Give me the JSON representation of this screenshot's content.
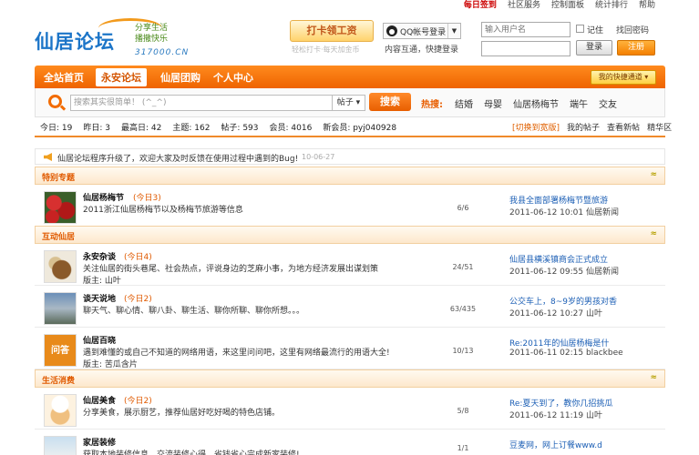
{
  "topbar": {
    "sign_in": "每日签到",
    "community": "社区服务",
    "control": "控制面板",
    "stats": "统计排行",
    "help": "帮助"
  },
  "logo": {
    "name": "仙居论坛",
    "slogan_1": "分享生活",
    "slogan_2": "播撒快乐",
    "domain": "317000.CN"
  },
  "punch": {
    "label": "打卡领工资",
    "sub": "轻松打卡·每天加金币"
  },
  "qq_login": {
    "label": "QQ帐号登录",
    "sub": "内容互通，快捷登录"
  },
  "login": {
    "username_placeholder": "输入用户名",
    "remember": "记住",
    "find_password": "找回密码",
    "login_label": "登录",
    "register_label": "注册"
  },
  "nav": {
    "items": [
      "全站首页",
      "永安论坛",
      "仙居团购",
      "个人中心"
    ],
    "quick_access": "我的快捷通道"
  },
  "search": {
    "placeholder": "搜索其实很简单！ (^_^)",
    "type": "帖子",
    "button": "搜索",
    "hot_label": "热搜:",
    "hot_tags": [
      "结婚",
      "母婴",
      "仙居杨梅节",
      "端午",
      "交友"
    ]
  },
  "stats": {
    "today": "今日: 19",
    "yesterday": "昨日: 3",
    "highest": "最高日: 42",
    "topics": "主题: 162",
    "posts": "帖子: 593",
    "members": "会员: 4016",
    "new_member": "新会员: pyj040928"
  },
  "stats_links": {
    "switch": "[切换到宽版]",
    "my_posts": "我的帖子",
    "new_posts": "查看新帖",
    "digest": "精华区"
  },
  "notice": {
    "text": "仙居论坛程序升级了，欢迎大家及时反馈在使用过程中遇到的Bug!",
    "date": "10-06-27"
  },
  "categories": [
    {
      "title": "特别专题",
      "collapse": "≈"
    },
    {
      "title": "互动仙居",
      "collapse": "≈"
    },
    {
      "title": "生活消费",
      "collapse": "≈"
    }
  ],
  "forums": [
    {
      "name": "仙居杨梅节",
      "today": "(今日3)",
      "desc": "2011浙江仙居杨梅节以及杨梅节旅游等信息",
      "mods": "",
      "counts": "6/6",
      "last_title": "我县全面部署杨梅节暨旅游",
      "last_meta": "2011-06-12 10:01 仙居新闻"
    },
    {
      "name": "永安杂谈",
      "today": "(今日4)",
      "desc": "关注仙居的街头巷尾、社会热点，评说身边的芝麻小事，为地方经济发展出谋划策",
      "mods": "版主: 山叶",
      "counts": "24/51",
      "last_title": "仙居县横溪镇商会正式成立",
      "last_meta": "2011-06-12 09:55 仙居新闻"
    },
    {
      "name": "谈天说地",
      "today": "(今日2)",
      "desc": "聊天气、聊心情、聊八卦、聊生活、聊你所聊、聊你所想。。。",
      "mods": "版主: 山叶",
      "counts": "63/435",
      "last_title": "公交车上，8~9岁的男孩对香",
      "last_meta": "2011-06-12 10:27 山叶"
    },
    {
      "name": "仙居百晓",
      "today": "",
      "desc": "遇到难懂的或自己不知道的网络用语，来这里问问吧，这里有网络最流行的用语大全!",
      "mods": "版主: 苦瓜含片",
      "counts": "10/13",
      "last_title": "Re:2011年的仙居杨梅是什",
      "last_meta": "2011-06-11 02:15 blackbee"
    },
    {
      "name": "仙居美食",
      "today": "(今日2)",
      "desc": "分享美食，展示厨艺，推荐仙居好吃好喝的特色店铺。",
      "mods": "",
      "counts": "5/8",
      "last_title": "Re:夏天到了，教你几招挑瓜",
      "last_meta": "2011-06-12 11:19 山叶"
    },
    {
      "name": "家居装修",
      "today": "",
      "desc": "获取本地装修信息，交流装修心得，省钱省心完成新家装修!",
      "mods": "",
      "counts": "1/1",
      "last_title": "豆麦网，网上订餐www.d",
      "last_meta": ""
    }
  ],
  "thumb_ask": "问答"
}
